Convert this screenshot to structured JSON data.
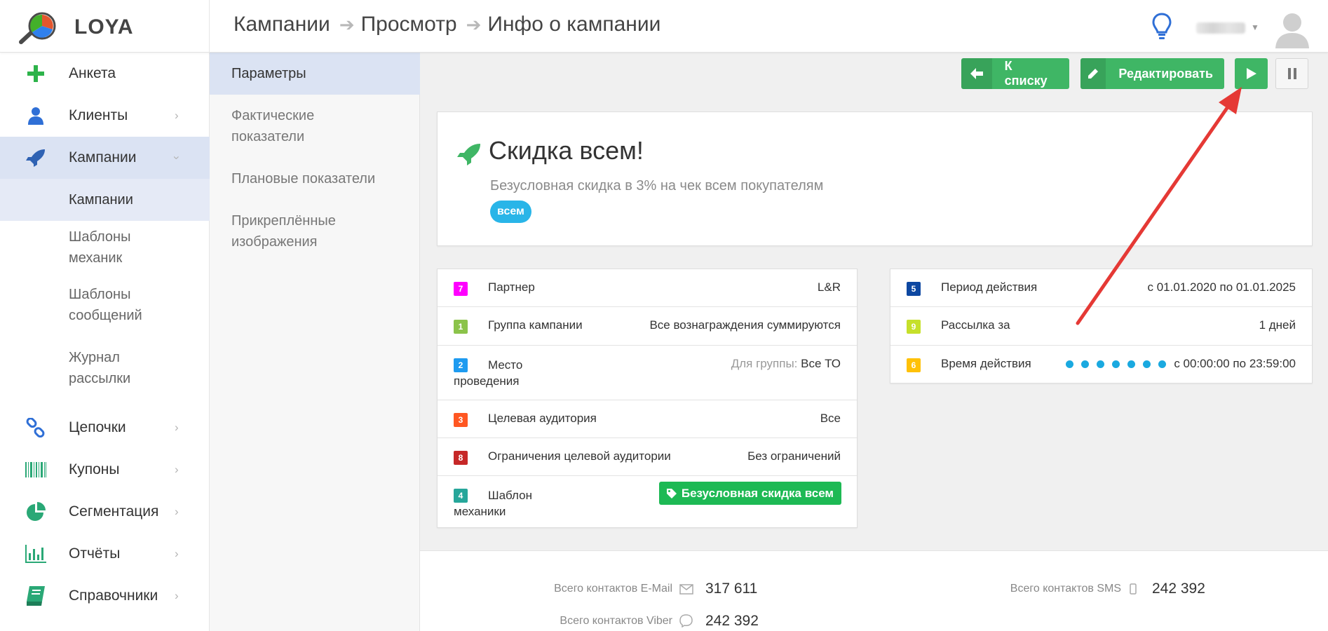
{
  "app": {
    "name": "LOYA",
    "colors": {
      "accent_green": "#3fb665",
      "tag_blue": "#29b5e8",
      "arrow_red": "#e53935"
    }
  },
  "header": {
    "breadcrumbs": [
      "Кампании",
      "Просмотр",
      "Инфо о кампании"
    ],
    "icons": {
      "hint": "lightbulb-icon",
      "user": "avatar"
    }
  },
  "sidebar": {
    "items": [
      {
        "label": "Анкета",
        "icon": "plus-icon"
      },
      {
        "label": "Клиенты",
        "icon": "user-icon"
      },
      {
        "label": "Кампании",
        "icon": "rocket-icon"
      },
      {
        "label": "Цепочки",
        "icon": "chain-icon"
      },
      {
        "label": "Купоны",
        "icon": "barcode-icon"
      },
      {
        "label": "Сегментация",
        "icon": "pie-icon"
      },
      {
        "label": "Отчёты",
        "icon": "bar-chart-icon"
      },
      {
        "label": "Справочники",
        "icon": "book-icon"
      }
    ],
    "subitems": [
      "Кампании",
      "Шаблоны механик",
      "Шаблоны сообщений",
      "Журнал рассылки"
    ]
  },
  "subnav": {
    "items": [
      "Параметры",
      "Фактические показатели",
      "Плановые показатели",
      "Прикреплённые изображения"
    ]
  },
  "toolbar": {
    "back_label": "К списку",
    "edit_label": "Редактировать"
  },
  "campaign": {
    "title": "Скидка всем!",
    "description": "Безусловная скидка в 3% на чек всем покупателям",
    "tag": "всем"
  },
  "left_table": [
    {
      "num": "7",
      "color": "#ff00ff",
      "label": "Партнер",
      "value": "L&R"
    },
    {
      "num": "1",
      "color": "#8bc34a",
      "label": "Группа кампании",
      "value": "Все вознаграждения суммируются"
    },
    {
      "num": "2",
      "color": "#1e9bf0",
      "label": "Место проведения",
      "value_muted": "Для группы:",
      "value": "Все ТО"
    },
    {
      "num": "3",
      "color": "#ff5722",
      "label": "Целевая аудитория",
      "value": "Все"
    },
    {
      "num": "8",
      "color": "#c62828",
      "label": "Ограничения целевой аудитории",
      "value": "Без ограничений"
    },
    {
      "num": "4",
      "color": "#26a69a",
      "label": "Шаблон механики",
      "value": "Безусловная скидка всем"
    }
  ],
  "right_table": [
    {
      "num": "5",
      "color": "#0d47a1",
      "label": "Период действия",
      "value": "с 01.01.2020 по 01.01.2025"
    },
    {
      "num": "9",
      "color": "#c6e02a",
      "label": "Рассылка за",
      "value": "1 дней"
    },
    {
      "num": "6",
      "color": "#ffc107",
      "label": "Время действия",
      "value": "с 00:00:00 по 23:59:00",
      "days_active": 7
    }
  ],
  "stats": {
    "email_label": "Всего контактов E-Mail",
    "email_value": "317 611",
    "sms_label": "Всего контактов SMS",
    "sms_value": "242 392",
    "viber_label": "Всего контактов Viber",
    "viber_value": "242 392"
  }
}
